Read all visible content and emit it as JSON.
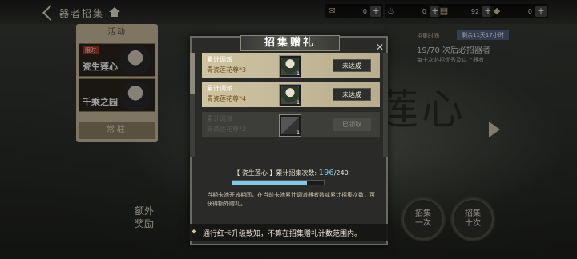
{
  "header": {
    "back_label": "器者招集",
    "currencies": [
      {
        "icon": "✉",
        "value": "0"
      },
      {
        "icon": "♨",
        "value": "0"
      },
      {
        "icon": "▤",
        "value": "92"
      },
      {
        "icon": "◆",
        "value": "0"
      }
    ],
    "plus": "+"
  },
  "left_panel": {
    "header": "活动",
    "cards": [
      {
        "tag": "限时",
        "title": "瓷生莲心"
      },
      {
        "tag": "",
        "title": "千乘之园"
      }
    ],
    "regular": "常驻"
  },
  "right_side": {
    "pool_tag": "招集时间",
    "pool_time": "剩余11天17小时",
    "guarantee": "19/70 次后必招器者",
    "guarantee_note": "每十次必招优秀及以上器者",
    "pull_one": "招集\n一次",
    "pull_ten": "招集\n十次"
  },
  "extra_reward": "额外\n奖励",
  "modal": {
    "title": "招集赠礼",
    "close": "✕",
    "tasks": [
      {
        "name": "累计调派",
        "reward": "青瓷莲花尊*3",
        "qty": "1",
        "button": "未达成",
        "state": "active"
      },
      {
        "name": "累计调派",
        "reward": "青瓷莲花尊*4",
        "qty": "1",
        "button": "未达成",
        "state": "active"
      },
      {
        "name": "累计调派",
        "reward": "青瓷莲花尊*2",
        "qty": "1",
        "button": "已领取",
        "state": "done"
      }
    ],
    "progress": {
      "label": "【 瓷生莲心 】累计招集次数: ",
      "current": "196",
      "total": "/240",
      "fraction": 0.8167
    },
    "description": "当期卡池开放期间，在当前卡池累计调派器者数或累计招集次数，可获得额外赠礼。"
  },
  "notice": "通行红卡升级致知，不算在招集赠礼计数范围内。"
}
